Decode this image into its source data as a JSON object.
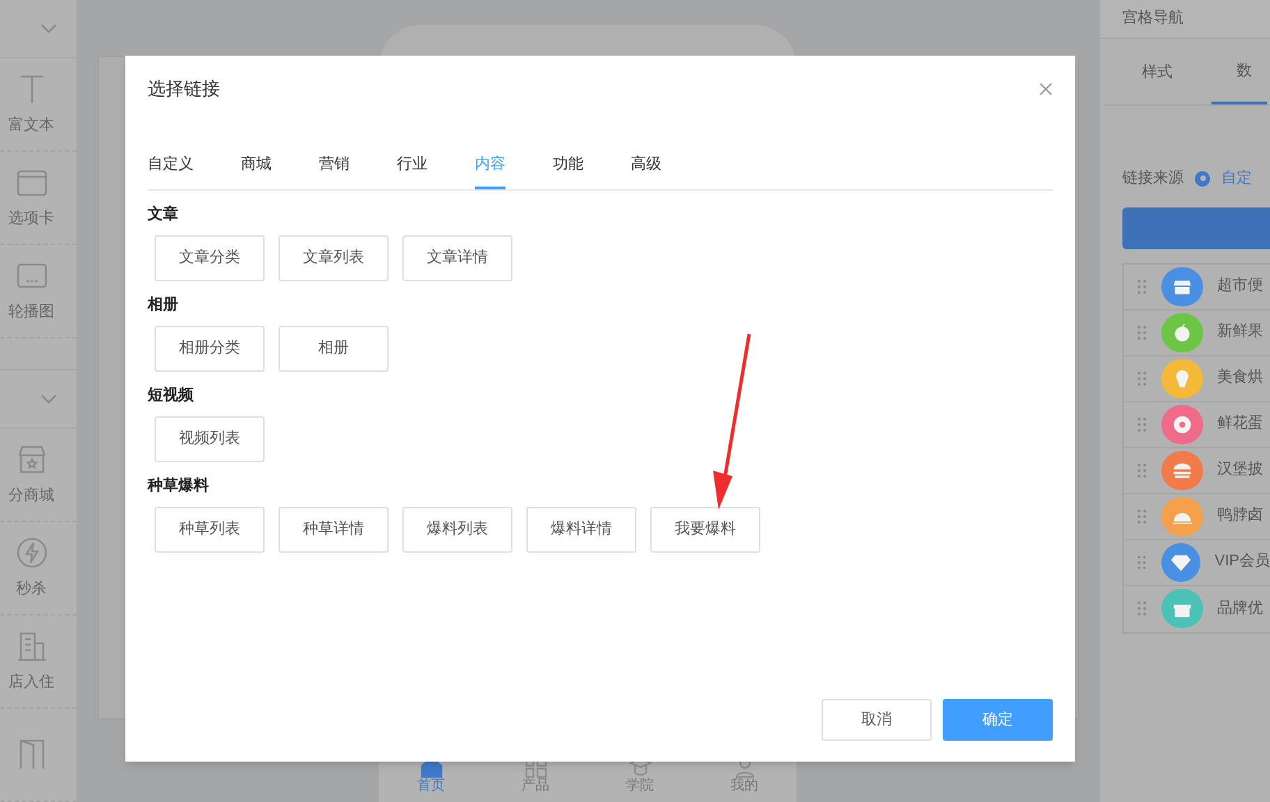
{
  "sidebar": {
    "groups": [
      {
        "items": [
          {
            "label": "富文本",
            "kind": "text"
          },
          {
            "label": "选项卡",
            "kind": "tab"
          },
          {
            "label": "轮播图",
            "kind": "carousel"
          }
        ]
      },
      {
        "items": [
          {
            "label": "分商城",
            "kind": "store"
          },
          {
            "label": "秒杀",
            "kind": "flash"
          },
          {
            "label": "店入住",
            "kind": "building"
          },
          {
            "kind": "door"
          }
        ]
      }
    ]
  },
  "phone": {
    "nav": [
      {
        "label": "首页",
        "kind": "home",
        "selected": true
      },
      {
        "label": "产品",
        "kind": "grid",
        "selected": false
      },
      {
        "label": "学院",
        "kind": "cap",
        "selected": false
      },
      {
        "label": "我的",
        "kind": "user",
        "selected": false
      }
    ]
  },
  "right_panel": {
    "title": "宫格导航",
    "tabs": [
      {
        "label": "样式",
        "selected": false
      },
      {
        "label": "数",
        "selected": true
      }
    ],
    "link_source_label": "链接来源",
    "link_source_option": "自定",
    "link_source_selected": true,
    "items": [
      {
        "label": "超市便",
        "color": "#4a90e2",
        "kind": "store"
      },
      {
        "label": "新鲜果",
        "color": "#6cc644",
        "kind": "apple"
      },
      {
        "label": "美食烘",
        "color": "#f5b93a",
        "kind": "cake"
      },
      {
        "label": "鲜花蛋",
        "color": "#f06a8a",
        "kind": "donut"
      },
      {
        "label": "汉堡披",
        "color": "#f37b4a",
        "kind": "burger"
      },
      {
        "label": "鸭脖卤",
        "color": "#f5a04a",
        "kind": "dish"
      },
      {
        "label": "VIP会员",
        "color": "#4a90e2",
        "kind": "diamond"
      },
      {
        "label": "品牌优",
        "color": "#4cc2b6",
        "kind": "gift"
      }
    ]
  },
  "dialog": {
    "title": "选择链接",
    "tabs": [
      {
        "label": "自定义",
        "selected": false
      },
      {
        "label": "商城",
        "selected": false
      },
      {
        "label": "营销",
        "selected": false
      },
      {
        "label": "行业",
        "selected": false
      },
      {
        "label": "内容",
        "selected": true
      },
      {
        "label": "功能",
        "selected": false
      },
      {
        "label": "高级",
        "selected": false
      }
    ],
    "sections": [
      {
        "title": "文章",
        "links": [
          "文章分类",
          "文章列表",
          "文章详情"
        ]
      },
      {
        "title": "相册",
        "links": [
          "相册分类",
          "相册"
        ]
      },
      {
        "title": "短视频",
        "links": [
          "视频列表"
        ]
      },
      {
        "title": "种草爆料",
        "links": [
          "种草列表",
          "种草详情",
          "爆料列表",
          "爆料详情",
          "我要爆料"
        ]
      }
    ],
    "buttons": [
      {
        "label": "取消",
        "kind": "secondary"
      },
      {
        "label": "确定",
        "kind": "primary"
      }
    ]
  }
}
